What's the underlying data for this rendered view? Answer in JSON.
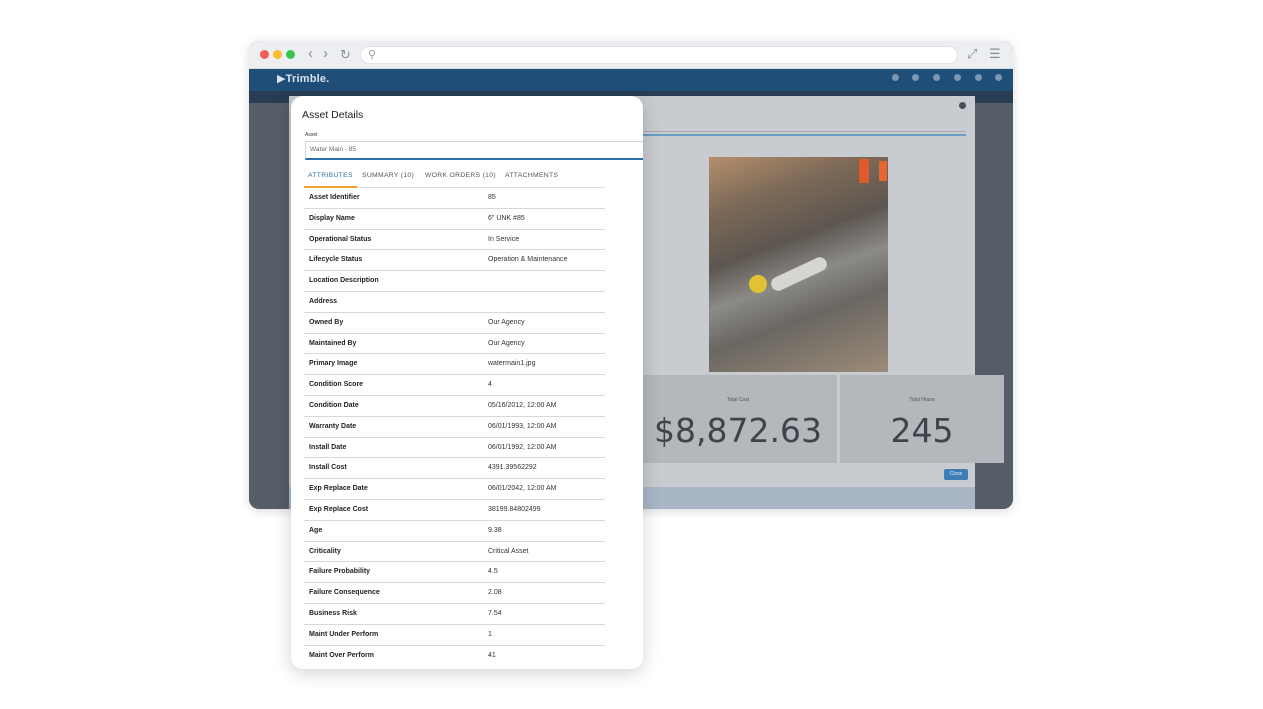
{
  "browser": {
    "url": "",
    "icons": {
      "back": "chevron-left-icon",
      "forward": "chevron-right-icon",
      "reload": "reload-icon",
      "search": "search-icon",
      "expand": "expand-icon",
      "menu": "hamburger-menu-icon"
    }
  },
  "app": {
    "brand": "▶Trimble.",
    "stats": [
      {
        "label": "Total Cost",
        "value": "$8,872.63"
      },
      {
        "label": "Total Hours",
        "value": "245"
      }
    ],
    "close_button": "Close"
  },
  "modal": {
    "title": "Asset Details",
    "asset_label": "Asset",
    "asset_value": "Water Main - 85",
    "tabs": [
      {
        "label": "ATTRIBUTES",
        "active": true
      },
      {
        "label": "SUMMARY (10)",
        "active": false
      },
      {
        "label": "WORK ORDERS (10)",
        "active": false
      },
      {
        "label": "ATTACHMENTS",
        "active": false
      }
    ],
    "rows": [
      {
        "label": "Asset Identifier",
        "value": "85"
      },
      {
        "label": "Display Name",
        "value": "6\" UNK #85"
      },
      {
        "label": "Operational Status",
        "value": "In Service"
      },
      {
        "label": "Lifecycle Status",
        "value": "Operation & Maintenance"
      },
      {
        "label": "Location Description",
        "value": ""
      },
      {
        "label": "Address",
        "value": ""
      },
      {
        "label": "Owned By",
        "value": "Our Agency"
      },
      {
        "label": "Maintained By",
        "value": "Our Agency"
      },
      {
        "label": "Primary Image",
        "value": "watermain1.jpg"
      },
      {
        "label": "Condition Score",
        "value": "4"
      },
      {
        "label": "Condition Date",
        "value": "05/16/2012, 12:00 AM"
      },
      {
        "label": "Warranty Date",
        "value": "06/01/1993, 12:00 AM"
      },
      {
        "label": "Install Date",
        "value": "06/01/1992, 12:00 AM"
      },
      {
        "label": "Install Cost",
        "value": "4391.39562292"
      },
      {
        "label": "Exp Replace Date",
        "value": "06/01/2042, 12:00 AM"
      },
      {
        "label": "Exp Replace Cost",
        "value": "38199.84802499"
      },
      {
        "label": "Age",
        "value": "9.38"
      },
      {
        "label": "Criticality",
        "value": "Critical Asset"
      },
      {
        "label": "Failure Probability",
        "value": "4.5"
      },
      {
        "label": "Failure Consequence",
        "value": "2.08"
      },
      {
        "label": "Business Risk",
        "value": "7.54"
      },
      {
        "label": "Maint Under Perform",
        "value": "1"
      },
      {
        "label": "Maint Over Perform",
        "value": "41"
      }
    ]
  }
}
